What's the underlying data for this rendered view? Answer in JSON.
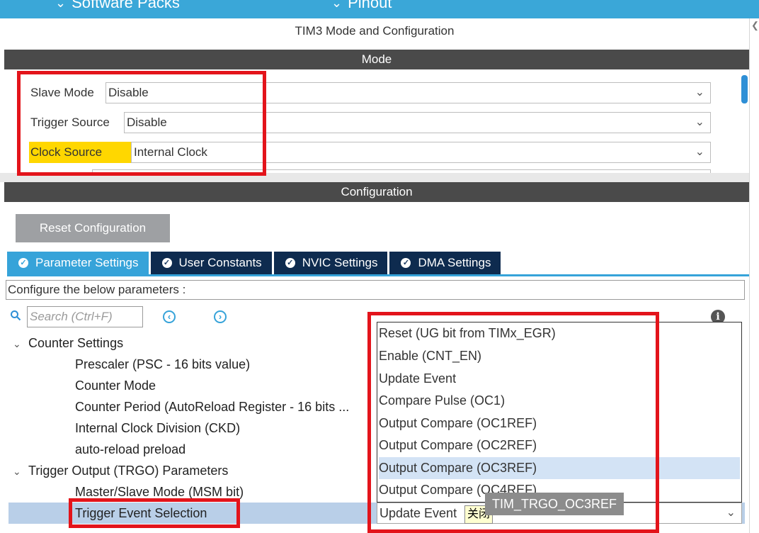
{
  "top_nav": [
    {
      "label": "Software Packs",
      "icon": "chevron-down-icon"
    },
    {
      "label": "Pinout",
      "icon": "chevron-down-icon"
    }
  ],
  "panel_title": "TIM3 Mode and Configuration",
  "mode_section": {
    "heading": "Mode",
    "fields": [
      {
        "label": "Slave Mode",
        "value": "Disable"
      },
      {
        "label": "Trigger Source",
        "value": "Disable"
      },
      {
        "label": "Clock Source",
        "value": "Internal Clock"
      }
    ]
  },
  "config_section": {
    "heading": "Configuration",
    "reset_button": "Reset Configuration",
    "tabs": [
      {
        "label": "Parameter Settings",
        "active": true
      },
      {
        "label": "User Constants",
        "active": false
      },
      {
        "label": "NVIC Settings",
        "active": false
      },
      {
        "label": "DMA Settings",
        "active": false
      }
    ],
    "configure_text": "Configure the below parameters :",
    "search_placeholder": "Search (Ctrl+F)"
  },
  "tree": {
    "counter_group": "Counter Settings",
    "counter_items": [
      "Prescaler (PSC - 16 bits value)",
      "Counter Mode",
      "Counter Period (AutoReload Register - 16 bits ...",
      "Internal Clock Division (CKD)",
      "auto-reload preload"
    ],
    "trgo_group": "Trigger Output (TRGO) Parameters",
    "trgo_items": [
      "Master/Slave Mode (MSM bit)",
      "Trigger Event Selection"
    ]
  },
  "dropdown_options": [
    "Reset (UG bit from TIMx_EGR)",
    "Enable (CNT_EN)",
    "Update Event",
    "Compare Pulse (OC1)",
    "Output Compare (OC1REF)",
    "Output Compare (OC2REF)",
    "Output Compare (OC3REF)",
    "Output Compare (OC4REF)"
  ],
  "highlighted_option": "Output Compare (OC3REF)",
  "selected_value": "Update Event",
  "close_label": "关闭",
  "tooltip": "TIM_TRGO_OC3REF",
  "colors": {
    "accent": "#36a3d9",
    "dark_tab": "#0e2b4f",
    "header": "#4a4a4a",
    "annotation_red": "#e3141b",
    "highlight_yellow": "#ffd700"
  }
}
